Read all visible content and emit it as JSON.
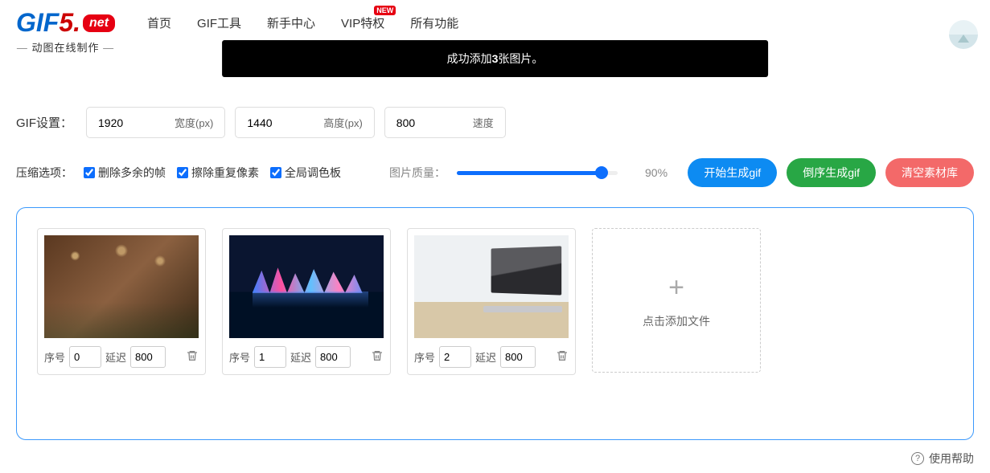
{
  "logo": {
    "p1": "GIF",
    "p2": "5.",
    "net": "net",
    "sub": "动图在线制作"
  },
  "nav": [
    {
      "label": "首页",
      "name": "nav-home"
    },
    {
      "label": "GIF工具",
      "name": "nav-gif-tools"
    },
    {
      "label": "新手中心",
      "name": "nav-newbie"
    },
    {
      "label": "VIP特权",
      "name": "nav-vip",
      "badge": "NEW"
    },
    {
      "label": "所有功能",
      "name": "nav-all"
    }
  ],
  "toast": {
    "prefix": "成功添加",
    "count": "3",
    "suffix": "张图片。"
  },
  "settings": {
    "title": "GIF设置：",
    "width": {
      "value": "1920",
      "unit": "宽度(px)"
    },
    "height": {
      "value": "1440",
      "unit": "高度(px)"
    },
    "speed": {
      "value": "800",
      "unit": "速度"
    }
  },
  "compress": {
    "title": "压缩选项：",
    "cb1": "删除多余的帧",
    "cb2": "擦除重复像素",
    "cb3": "全局调色板"
  },
  "quality": {
    "label": "图片质量：",
    "value": "90%"
  },
  "buttons": {
    "start": "开始生成gif",
    "reverse": "倒序生成gif",
    "clear": "清空素材库"
  },
  "frames": [
    {
      "seq": "0",
      "delay": "800"
    },
    {
      "seq": "1",
      "delay": "800"
    },
    {
      "seq": "2",
      "delay": "800"
    }
  ],
  "frame_labels": {
    "seq": "序号",
    "delay": "延迟"
  },
  "add_card": {
    "text": "点击添加文件",
    "plus": "+"
  },
  "help": "使用帮助"
}
